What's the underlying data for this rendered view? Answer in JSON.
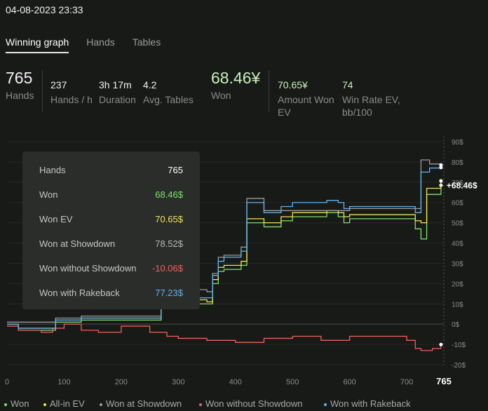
{
  "datetime": "04-08-2023 23:33",
  "tabs": [
    {
      "label": "Winning graph",
      "active": true
    },
    {
      "label": "Hands",
      "active": false
    },
    {
      "label": "Tables",
      "active": false
    }
  ],
  "stats": {
    "hands": {
      "value": "765",
      "label": "Hands"
    },
    "hands_per_hour": {
      "value": "237",
      "label": "Hands / h"
    },
    "duration": {
      "value": "3h 17m",
      "label": "Duration"
    },
    "avg_tables": {
      "value": "4.2",
      "label": "Avg. Tables"
    },
    "won": {
      "value": "68.46¥",
      "label": "Won"
    },
    "amount_won_ev": {
      "value": "70.65¥",
      "label_line1": "Amount Won",
      "label_line2": "EV"
    },
    "win_rate_ev": {
      "value": "74",
      "label_line1": "Win Rate EV,",
      "label_line2": "bb/100"
    }
  },
  "tooltip": {
    "rows": [
      {
        "key": "Hands",
        "value": "765",
        "color": "#ffffff"
      },
      {
        "key": "Won",
        "value": "68.46$",
        "color": "#7ee36a"
      },
      {
        "key": "Won EV",
        "value": "70.65$",
        "color": "#f2e35a"
      },
      {
        "key": "Won at Showdown",
        "value": "78.52$",
        "color": "#b8b8b8"
      },
      {
        "key": "Won without Showdown",
        "value": "-10.06$",
        "color": "#f0605a"
      },
      {
        "key": "Won with Rakeback",
        "value": "77.23$",
        "color": "#5fb4f0"
      }
    ]
  },
  "end_label": "+68.46$",
  "x_end_label": "765",
  "colors": {
    "won": "#7ee36a",
    "all_in_ev": "#f2e35a",
    "showdown": "#9a9a9a",
    "no_showdown": "#f0605a",
    "rakeback": "#5fb4f0"
  },
  "legend": [
    {
      "label": "Won",
      "color": "#7ee36a"
    },
    {
      "label": "All-in EV",
      "color": "#f2e35a"
    },
    {
      "label": "Won at Showdown",
      "color": "#9a9a9a"
    },
    {
      "label": "Won without Showdown",
      "color": "#f0605a"
    },
    {
      "label": "Won with Rakeback",
      "color": "#5fb4f0"
    }
  ],
  "chart_data": {
    "type": "line",
    "x_ticks": [
      "0",
      "100",
      "200",
      "300",
      "400",
      "500",
      "600",
      "700"
    ],
    "y_ticks": [
      "90$",
      "80$",
      "70$",
      "60$",
      "50$",
      "40$",
      "30$",
      "20$",
      "10$",
      "0$",
      "-10$",
      "-20$"
    ],
    "xlim": [
      0,
      765
    ],
    "ylim": [
      -20,
      90
    ],
    "series": [
      {
        "name": "Won",
        "color": "#7ee36a",
        "points": [
          [
            0,
            0
          ],
          [
            20,
            -3
          ],
          [
            80,
            -3
          ],
          [
            85,
            1
          ],
          [
            130,
            2
          ],
          [
            270,
            15
          ],
          [
            300,
            19
          ],
          [
            305,
            10
          ],
          [
            350,
            10
          ],
          [
            360,
            20
          ],
          [
            370,
            26
          ],
          [
            380,
            27
          ],
          [
            410,
            29
          ],
          [
            420,
            50
          ],
          [
            440,
            50
          ],
          [
            450,
            48
          ],
          [
            480,
            51
          ],
          [
            500,
            53
          ],
          [
            560,
            55
          ],
          [
            580,
            53
          ],
          [
            590,
            50
          ],
          [
            600,
            52
          ],
          [
            715,
            47
          ],
          [
            725,
            42
          ],
          [
            735,
            64
          ],
          [
            760,
            68.46
          ]
        ]
      },
      {
        "name": "All-in EV",
        "color": "#f2e35a",
        "points": [
          [
            0,
            0
          ],
          [
            20,
            -2
          ],
          [
            80,
            -2
          ],
          [
            85,
            2
          ],
          [
            130,
            3
          ],
          [
            270,
            17
          ],
          [
            300,
            20
          ],
          [
            305,
            12
          ],
          [
            350,
            11
          ],
          [
            360,
            22
          ],
          [
            370,
            28
          ],
          [
            380,
            29
          ],
          [
            410,
            31
          ],
          [
            420,
            52
          ],
          [
            440,
            52
          ],
          [
            450,
            50
          ],
          [
            480,
            53
          ],
          [
            500,
            55
          ],
          [
            560,
            56
          ],
          [
            580,
            55
          ],
          [
            590,
            53
          ],
          [
            600,
            54
          ],
          [
            715,
            51
          ],
          [
            725,
            50
          ],
          [
            735,
            67
          ],
          [
            760,
            70.65
          ]
        ]
      },
      {
        "name": "Won at Showdown",
        "color": "#9a9a9a",
        "points": [
          [
            0,
            1
          ],
          [
            75,
            1
          ],
          [
            80,
            1
          ],
          [
            85,
            3
          ],
          [
            130,
            4
          ],
          [
            270,
            21
          ],
          [
            300,
            20
          ],
          [
            305,
            17
          ],
          [
            350,
            16
          ],
          [
            360,
            25
          ],
          [
            370,
            33
          ],
          [
            380,
            34
          ],
          [
            410,
            38
          ],
          [
            420,
            62
          ],
          [
            440,
            62
          ],
          [
            450,
            56
          ],
          [
            590,
            56
          ],
          [
            600,
            57
          ],
          [
            715,
            57
          ],
          [
            725,
            81
          ],
          [
            740,
            79
          ],
          [
            760,
            78.52
          ]
        ]
      },
      {
        "name": "Won without Showdown",
        "color": "#f0605a",
        "points": [
          [
            0,
            -1
          ],
          [
            20,
            -3
          ],
          [
            60,
            -4
          ],
          [
            80,
            -2
          ],
          [
            100,
            0
          ],
          [
            130,
            -3
          ],
          [
            160,
            -4
          ],
          [
            200,
            -1
          ],
          [
            250,
            -4
          ],
          [
            280,
            -6
          ],
          [
            300,
            -7
          ],
          [
            350,
            -8
          ],
          [
            400,
            -9
          ],
          [
            450,
            -7
          ],
          [
            500,
            -6
          ],
          [
            550,
            -8
          ],
          [
            600,
            -6
          ],
          [
            650,
            -6
          ],
          [
            700,
            -8
          ],
          [
            715,
            -12
          ],
          [
            725,
            -13
          ],
          [
            745,
            -12
          ],
          [
            760,
            -10.06
          ]
        ]
      },
      {
        "name": "Won with Rakeback",
        "color": "#5fb4f0",
        "points": [
          [
            0,
            0
          ],
          [
            20,
            -2
          ],
          [
            80,
            -2
          ],
          [
            85,
            2
          ],
          [
            130,
            3
          ],
          [
            270,
            18
          ],
          [
            300,
            21
          ],
          [
            305,
            13
          ],
          [
            350,
            13
          ],
          [
            360,
            24
          ],
          [
            370,
            31
          ],
          [
            380,
            33
          ],
          [
            410,
            36
          ],
          [
            420,
            60
          ],
          [
            440,
            60
          ],
          [
            450,
            55
          ],
          [
            480,
            58
          ],
          [
            500,
            60
          ],
          [
            560,
            61
          ],
          [
            580,
            60
          ],
          [
            590,
            57
          ],
          [
            600,
            58
          ],
          [
            715,
            55
          ],
          [
            725,
            75
          ],
          [
            740,
            77
          ],
          [
            760,
            77.23
          ]
        ]
      }
    ]
  }
}
